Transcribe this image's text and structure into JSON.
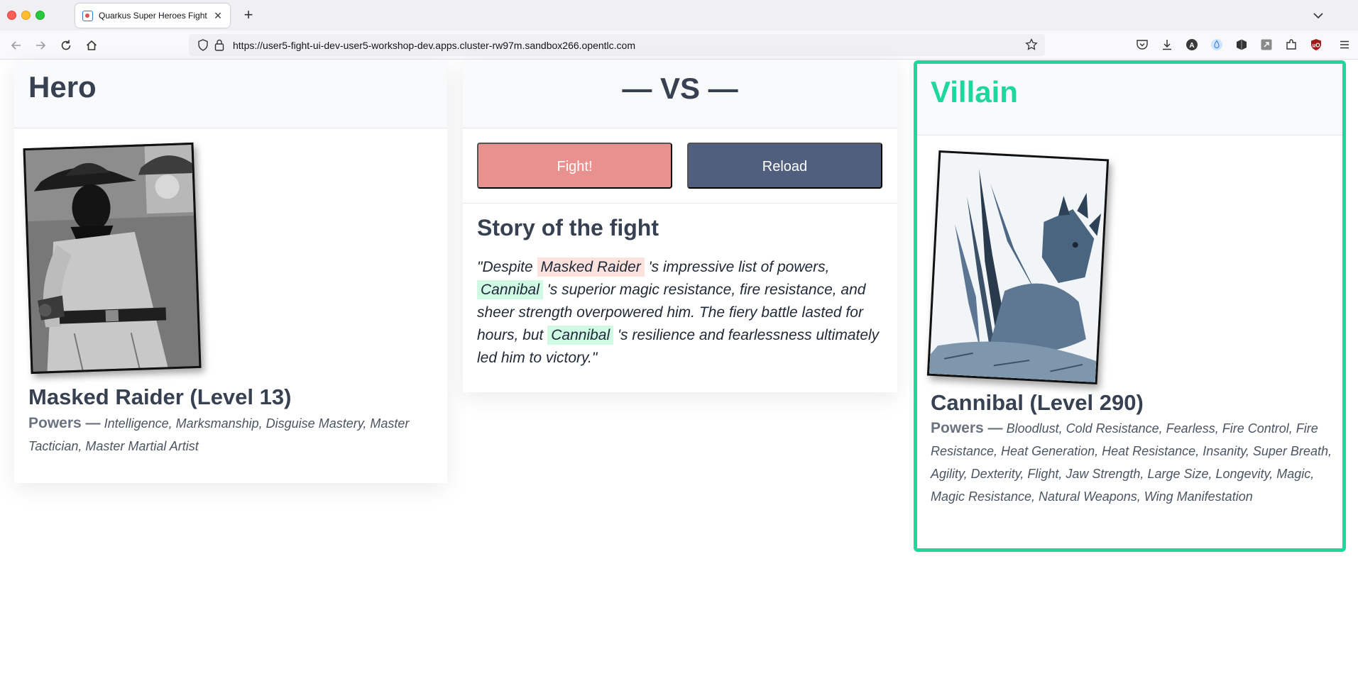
{
  "browser": {
    "tab_title": "Quarkus Super Heroes Fight",
    "url": "https://user5-fight-ui-dev-user5-workshop-dev.apps.cluster-rw97m.sandbox266.opentlc.com"
  },
  "colors": {
    "accent_villain": "#1ed79b",
    "fight_button": "#e8918f",
    "reload_button": "#505f7d",
    "hero_highlight": "#fde2de",
    "villain_highlight": "#d1fae5"
  },
  "hero": {
    "column_title": "Hero",
    "name_line": "Masked Raider (Level 13)",
    "powers_label": "Powers —",
    "powers": "Intelligence, Marksmanship, Disguise Mastery, Master Tactician, Master Martial Artist"
  },
  "vs": {
    "title": "— VS —",
    "fight_label": "Fight!",
    "reload_label": "Reload",
    "story_title": "Story of the fight",
    "story": {
      "p1": "\"Despite",
      "hero_name": "Masked Raider",
      "p2": "'s impressive list of powers,",
      "villain_name_1": "Cannibal",
      "p3": "'s superior magic resistance, fire resistance, and sheer strength overpowered him. The fiery battle lasted for hours, but",
      "villain_name_2": "Cannibal",
      "p4": "'s resilience and fearlessness ultimately led him to victory.\""
    }
  },
  "villain": {
    "column_title": "Villain",
    "name_line": "Cannibal (Level 290)",
    "powers_label": "Powers —",
    "powers": "Bloodlust, Cold Resistance, Fearless, Fire Control, Fire Resistance, Heat Generation, Heat Resistance, Insanity, Super Breath, Agility, Dexterity, Flight, Jaw Strength, Large Size, Longevity, Magic, Magic Resistance, Natural Weapons, Wing Manifestation"
  }
}
